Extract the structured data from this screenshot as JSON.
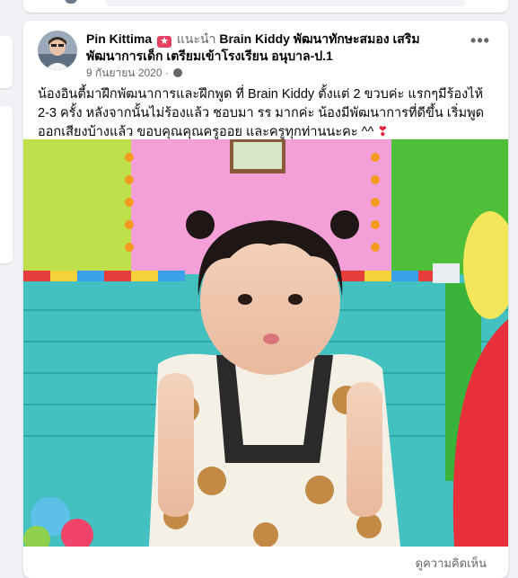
{
  "post": {
    "author_name": "Pin Kittima",
    "badge_glyph": "★",
    "recommends": "แนะนำ",
    "page_name": "Brain Kiddy พัฒนาทักษะสมอง เสริมพัฒนาการเด็ก เตรียมเข้าโรงเรียน อนุบาล-ป.1",
    "date": "9 กันยายน 2020",
    "separator": "·",
    "more_label": "•••",
    "text": "น้องอินตี้มาฝึกพัฒนาการและฝึกพูด ที่ Brain Kiddy ตั้งแต่ 2 ขวบค่ะ แรกๆมีร้องไห้ 2-3 ครั้ง หลังจากนั้นไม่ร้องแล้ว ชอบมา รร มากค่ะ น้องมีพัฒนาการที่ดีขึ้น เริ่มพูดออกเสียงบ้างแล้ว ขอบคุณคุณครูออย และครูทุกท่านนะคะ ^^",
    "heart": "❣",
    "footer_partial": "ดูความคิดเห็น"
  },
  "icons": {
    "badge": "rising-star-icon",
    "globe": "globe-icon",
    "more": "more-options-icon"
  },
  "colors": {
    "badge": "#e4405f",
    "heart": "#e41e3f",
    "secondary_text": "#65676b"
  }
}
